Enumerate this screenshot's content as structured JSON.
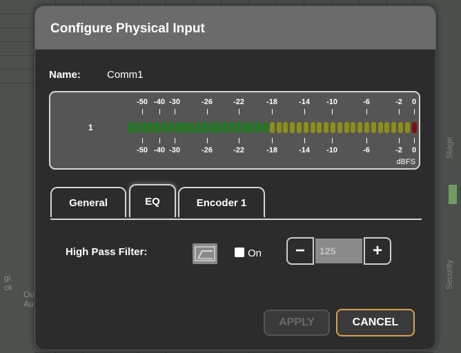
{
  "dialog": {
    "title": "Configure Physical Input",
    "name_label": "Name:",
    "name_value": "Comm1"
  },
  "meter": {
    "channel": "1",
    "ticks": [
      "-50",
      "-40",
      "-30",
      "-26",
      "-22",
      "-18",
      "-14",
      "-10",
      "-6",
      "-2",
      "0"
    ],
    "unit": "dBFS",
    "colors": {
      "green": "#1f7a1f",
      "yellow": "#8a8f1a",
      "red": "#7a0f0f"
    }
  },
  "tabs": [
    {
      "label": "General",
      "active": false
    },
    {
      "label": "EQ",
      "active": true
    },
    {
      "label": "Encoder 1",
      "active": false
    }
  ],
  "eq": {
    "hpf_label": "High Pass Filter:",
    "hpf_icon": "high-pass-filter-icon",
    "on_label": "On",
    "on_checked": false,
    "frequency": "125",
    "minus": "−",
    "plus": "+"
  },
  "buttons": {
    "apply": "APPLY",
    "cancel": "CANCEL"
  },
  "background": {
    "left_text_1": "gi\nck",
    "left_text_2": "Ou\nAu",
    "right_text_1": "Stage",
    "right_text_2": "Security"
  }
}
